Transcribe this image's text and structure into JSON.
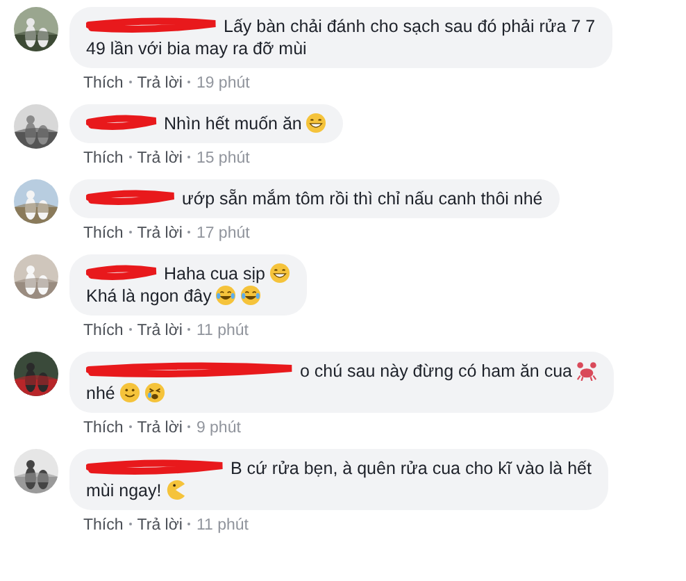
{
  "comments": [
    {
      "avatar": {
        "kind": "picture"
      },
      "name_redacted": true,
      "body": [
        {
          "kind": "text",
          "text": "Lấy bàn chải đánh cho sạch sau đó phải rửa 7 7"
        },
        {
          "kind": "break"
        },
        {
          "kind": "text",
          "text": "49 lần với bia may ra đỡ mùi"
        }
      ],
      "actions": {
        "like": "Thích",
        "reply": "Trả lời",
        "time": "19 phút"
      }
    },
    {
      "avatar": {
        "kind": "picture"
      },
      "name_redacted": true,
      "body": [
        {
          "kind": "text",
          "text": "Nhìn hết muốn ăn"
        },
        {
          "kind": "grin"
        }
      ],
      "actions": {
        "like": "Thích",
        "reply": "Trả lời",
        "time": "15 phút"
      }
    },
    {
      "avatar": {
        "kind": "picture"
      },
      "name_redacted": true,
      "body": [
        {
          "kind": "text",
          "text": "ướp sẵn mắm tôm rồi thì chỉ nấu canh thôi nhé"
        }
      ],
      "actions": {
        "like": "Thích",
        "reply": "Trả lời",
        "time": "17 phút"
      }
    },
    {
      "avatar": {
        "kind": "picture"
      },
      "name_redacted": true,
      "body": [
        {
          "kind": "text",
          "text": "Haha cua sịp"
        },
        {
          "kind": "grin"
        },
        {
          "kind": "break"
        },
        {
          "kind": "text",
          "text": "Khá là ngon đây"
        },
        {
          "kind": "laugh"
        },
        {
          "kind": "laugh"
        }
      ],
      "actions": {
        "like": "Thích",
        "reply": "Trả lời",
        "time": "11 phút"
      }
    },
    {
      "avatar": {
        "kind": "picture"
      },
      "name_redacted": true,
      "body": [
        {
          "kind": "text",
          "text": "o chú sau này đừng có ham ăn cua"
        },
        {
          "kind": "crab"
        },
        {
          "kind": "break"
        },
        {
          "kind": "text",
          "text": "nhé"
        },
        {
          "kind": "smile"
        },
        {
          "kind": "tired"
        }
      ],
      "actions": {
        "like": "Thích",
        "reply": "Trả lời",
        "time": "9 phút"
      }
    },
    {
      "avatar": {
        "kind": "picture"
      },
      "name_redacted": true,
      "body": [
        {
          "kind": "text",
          "text": "B cứ rửa bẹn, à quên rửa cua cho kĩ vào là hết"
        },
        {
          "kind": "break"
        },
        {
          "kind": "text",
          "text": "mùi ngay!"
        },
        {
          "kind": "pacman"
        }
      ],
      "actions": {
        "like": "Thích",
        "reply": "Trả lời",
        "time": "11 phút"
      }
    }
  ]
}
